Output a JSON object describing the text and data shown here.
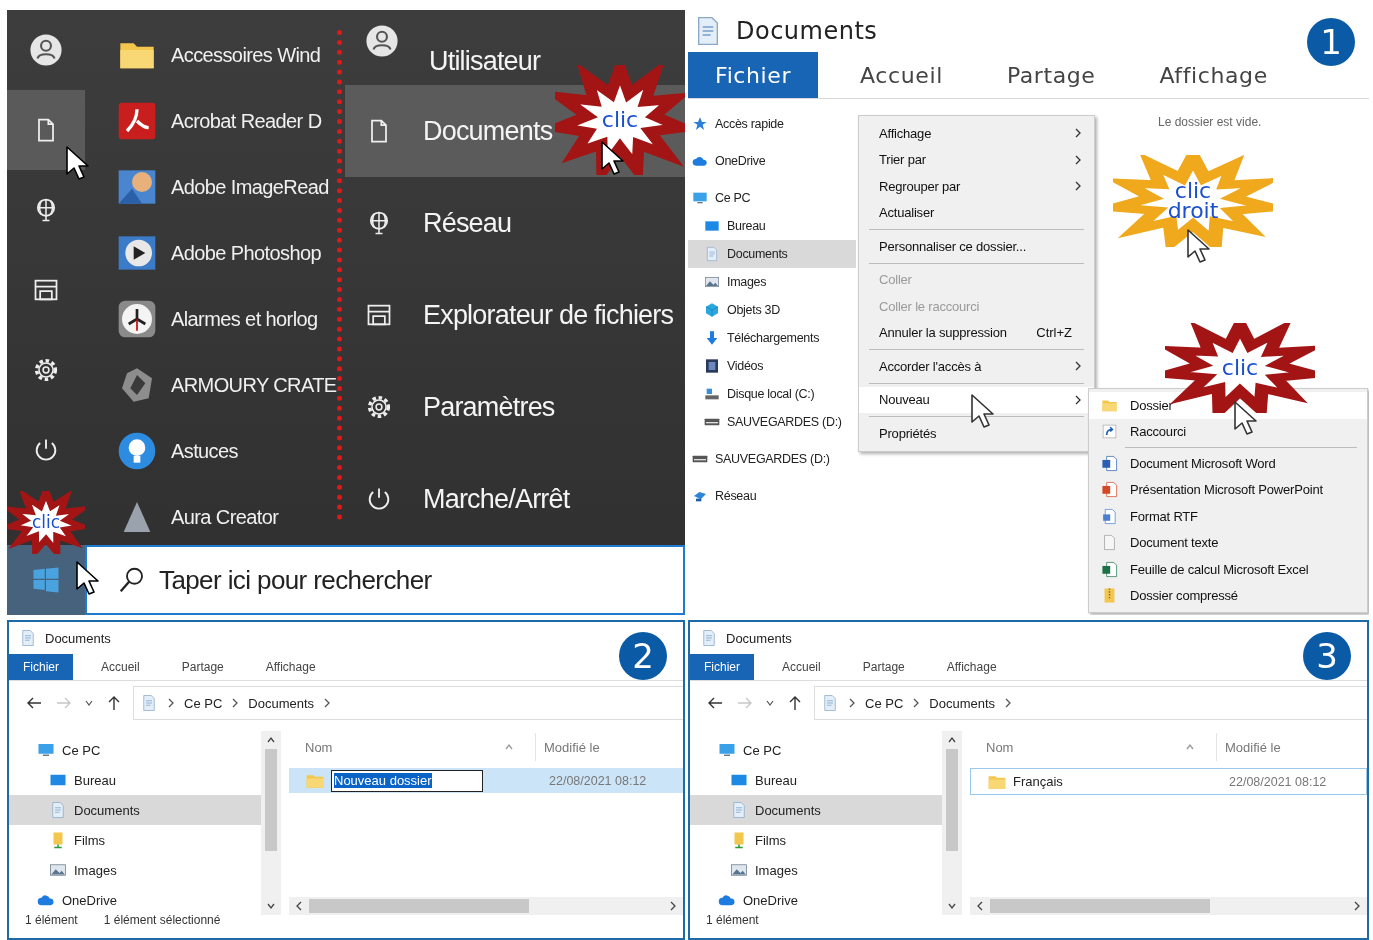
{
  "start_menu": {
    "rail": [
      {
        "kind": "user",
        "selected": false
      },
      {
        "kind": "document",
        "selected": true
      },
      {
        "kind": "network",
        "selected": false
      },
      {
        "kind": "explorer",
        "selected": false
      },
      {
        "kind": "settings",
        "selected": false
      },
      {
        "kind": "power",
        "selected": false
      }
    ],
    "apps": [
      {
        "name": "Accessoires Wind",
        "kind": "folder"
      },
      {
        "name": "Acrobat Reader D",
        "kind": "pdf"
      },
      {
        "name": "Adobe ImageRead",
        "kind": "imageready"
      },
      {
        "name": "Adobe Photoshop",
        "kind": "photoshop"
      },
      {
        "name": "Alarmes et horlog",
        "kind": "clock"
      },
      {
        "name": "ARMOURY CRATE",
        "kind": "armoury"
      },
      {
        "name": "Astuces",
        "kind": "bulb"
      },
      {
        "name": "Aura Creator",
        "kind": "aura"
      }
    ],
    "menu": [
      {
        "label": "Utilisateur",
        "kind": "user",
        "selected": false
      },
      {
        "label": "Documents",
        "kind": "document",
        "selected": true
      },
      {
        "label": "Réseau",
        "kind": "network",
        "selected": false
      },
      {
        "label": "Explorateur de fichiers",
        "kind": "explorer",
        "selected": false
      },
      {
        "label": "Paramètres",
        "kind": "settings",
        "selected": false
      },
      {
        "label": "Marche/Arrêt",
        "kind": "power",
        "selected": false
      }
    ],
    "search": {
      "placeholder": "Taper ici pour rechercher"
    },
    "callouts": [
      {
        "text": "clic",
        "color": "#a31515"
      },
      {
        "text": "clic",
        "color": "#a31515"
      }
    ]
  },
  "explorer_1": {
    "step": "1",
    "title": "Documents",
    "tabs": [
      {
        "label": "Fichier",
        "selected": true
      },
      {
        "label": "Accueil",
        "selected": false
      },
      {
        "label": "Partage",
        "selected": false
      },
      {
        "label": "Affichage",
        "selected": false
      }
    ],
    "nav": [
      {
        "label": "Accès rapide",
        "kind": "star",
        "selected": false
      },
      {
        "label": "OneDrive",
        "kind": "cloud",
        "selected": false
      },
      {
        "label": "Ce PC",
        "kind": "pc",
        "selected": false,
        "children": [
          {
            "label": "Bureau",
            "kind": "desktop",
            "selected": false
          },
          {
            "label": "Documents",
            "kind": "docs",
            "selected": true
          },
          {
            "label": "Images",
            "kind": "images",
            "selected": false
          },
          {
            "label": "Objets 3D",
            "kind": "cube",
            "selected": false
          },
          {
            "label": "Téléchargements",
            "kind": "download",
            "selected": false
          },
          {
            "label": "Vidéos",
            "kind": "video",
            "selected": false
          },
          {
            "label": "Disque local (C:)",
            "kind": "disk",
            "selected": false
          },
          {
            "label": "SAUVEGARDES (D:)",
            "kind": "drive",
            "selected": false
          }
        ]
      },
      {
        "label": "SAUVEGARDES (D:)",
        "kind": "drive",
        "selected": false
      },
      {
        "label": "Réseau",
        "kind": "lan",
        "selected": false
      }
    ],
    "empty_message": "Le dossier est vide.",
    "context_menu": [
      {
        "kind": "submenu",
        "label": "Affichage",
        "disabled": false,
        "selected": false
      },
      {
        "kind": "submenu",
        "label": "Trier par",
        "disabled": false,
        "selected": false
      },
      {
        "kind": "submenu",
        "label": "Regrouper par",
        "disabled": false,
        "selected": false
      },
      {
        "kind": "item",
        "label": "Actualiser",
        "disabled": false,
        "selected": false
      },
      {
        "kind": "separator"
      },
      {
        "kind": "item",
        "label": "Personnaliser ce dossier...",
        "disabled": false,
        "selected": false
      },
      {
        "kind": "separator"
      },
      {
        "kind": "item",
        "label": "Coller",
        "disabled": true,
        "selected": false
      },
      {
        "kind": "item",
        "label": "Coller le raccourci",
        "disabled": true,
        "selected": false
      },
      {
        "kind": "item",
        "label": "Annuler la suppression",
        "shortcut": "Ctrl+Z",
        "disabled": false,
        "selected": false
      },
      {
        "kind": "separator"
      },
      {
        "kind": "submenu",
        "label": "Accorder l'accès à",
        "disabled": false,
        "selected": false
      },
      {
        "kind": "separator"
      },
      {
        "kind": "submenu",
        "label": "Nouveau",
        "disabled": false,
        "selected": true
      },
      {
        "kind": "separator"
      },
      {
        "kind": "item",
        "label": "Propriétés",
        "disabled": false,
        "selected": false
      }
    ],
    "submenu": [
      {
        "kind": "folder",
        "label": "Dossier",
        "selected": true
      },
      {
        "kind": "shortcut",
        "label": "Raccourci",
        "selected": false
      },
      {
        "kind": "separator"
      },
      {
        "kind": "word",
        "label": "Document Microsoft Word",
        "selected": false
      },
      {
        "kind": "ppt",
        "label": "Présentation Microsoft PowerPoint",
        "selected": false
      },
      {
        "kind": "rtf",
        "label": "Format RTF",
        "selected": false
      },
      {
        "kind": "txt",
        "label": "Document texte",
        "selected": false
      },
      {
        "kind": "excel",
        "label": "Feuille de calcul Microsoft Excel",
        "selected": false
      },
      {
        "kind": "zip",
        "label": "Dossier compressé",
        "selected": false
      }
    ],
    "callouts": [
      {
        "text": "clic droit",
        "color": "#f0a81c"
      },
      {
        "text": "clic",
        "color": "#a31515"
      }
    ]
  },
  "explorer_2": {
    "step": "2",
    "title": "Documents",
    "tabs": [
      {
        "label": "Fichier",
        "selected": true
      },
      {
        "label": "Accueil",
        "selected": false
      },
      {
        "label": "Partage",
        "selected": false
      },
      {
        "label": "Affichage",
        "selected": false
      }
    ],
    "breadcrumb": [
      "Ce PC",
      "Documents"
    ],
    "nav": [
      {
        "label": "Ce PC",
        "kind": "pc",
        "selected": false,
        "children": [
          {
            "label": "Bureau",
            "kind": "desktop",
            "selected": false
          },
          {
            "label": "Documents",
            "kind": "docs",
            "selected": true
          },
          {
            "label": "Films",
            "kind": "films",
            "selected": false
          },
          {
            "label": "Images",
            "kind": "images",
            "selected": false
          }
        ]
      },
      {
        "label": "OneDrive",
        "kind": "cloud",
        "selected": false
      }
    ],
    "columns": [
      "Nom",
      "Modifié le"
    ],
    "rows": [
      {
        "name": "Nouveau dossier",
        "modified": "22/08/2021 08:12",
        "selected": true,
        "editing": true
      }
    ],
    "status": [
      "1 élément",
      "1 élément sélectionné"
    ]
  },
  "explorer_3": {
    "step": "3",
    "title": "Documents",
    "tabs": [
      {
        "label": "Fichier",
        "selected": true
      },
      {
        "label": "Accueil",
        "selected": false
      },
      {
        "label": "Partage",
        "selected": false
      },
      {
        "label": "Affichage",
        "selected": false
      }
    ],
    "breadcrumb": [
      "Ce PC",
      "Documents"
    ],
    "nav": [
      {
        "label": "Ce PC",
        "kind": "pc",
        "selected": false,
        "children": [
          {
            "label": "Bureau",
            "kind": "desktop",
            "selected": false
          },
          {
            "label": "Documents",
            "kind": "docs",
            "selected": true
          },
          {
            "label": "Films",
            "kind": "films",
            "selected": false
          },
          {
            "label": "Images",
            "kind": "images",
            "selected": false
          }
        ]
      },
      {
        "label": "OneDrive",
        "kind": "cloud",
        "selected": false
      }
    ],
    "columns": [
      "Nom",
      "Modifié le"
    ],
    "rows": [
      {
        "name": "Français",
        "modified": "22/08/2021 08:12",
        "selected": false,
        "editing": false
      }
    ],
    "status": [
      "1 élément"
    ]
  }
}
